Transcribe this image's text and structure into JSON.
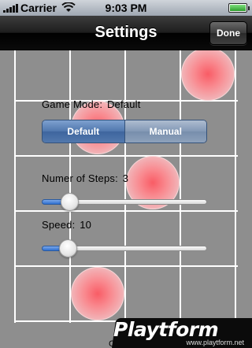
{
  "status_bar": {
    "carrier": "Carrier",
    "time": "9:03 PM",
    "battery_level": 1.0
  },
  "nav_bar": {
    "title": "Settings",
    "done_label": "Done"
  },
  "settings": {
    "game_mode_label": "Game Mode:",
    "game_mode_value": "Default",
    "segments": [
      "Default",
      "Manual"
    ],
    "selected_segment": "Default",
    "steps_label": "Numer of Steps:",
    "steps_value": "3",
    "steps_slider_fraction": 0.13,
    "speed_label": "Speed:",
    "speed_value": "10",
    "speed_slider_fraction": 0.12
  },
  "footer": {
    "credit_partial": "Cre"
  },
  "watermark": {
    "logo_text": "Playtform",
    "url": "www.playtform.net"
  },
  "colors": {
    "background": "#8e8e8e",
    "grid_lines": "#ffffff",
    "ball": "#ff5a64",
    "segment_selected": "#4f76ad",
    "slider_fill": "#2f6fd0",
    "watermark_accent": "#f47b20"
  }
}
